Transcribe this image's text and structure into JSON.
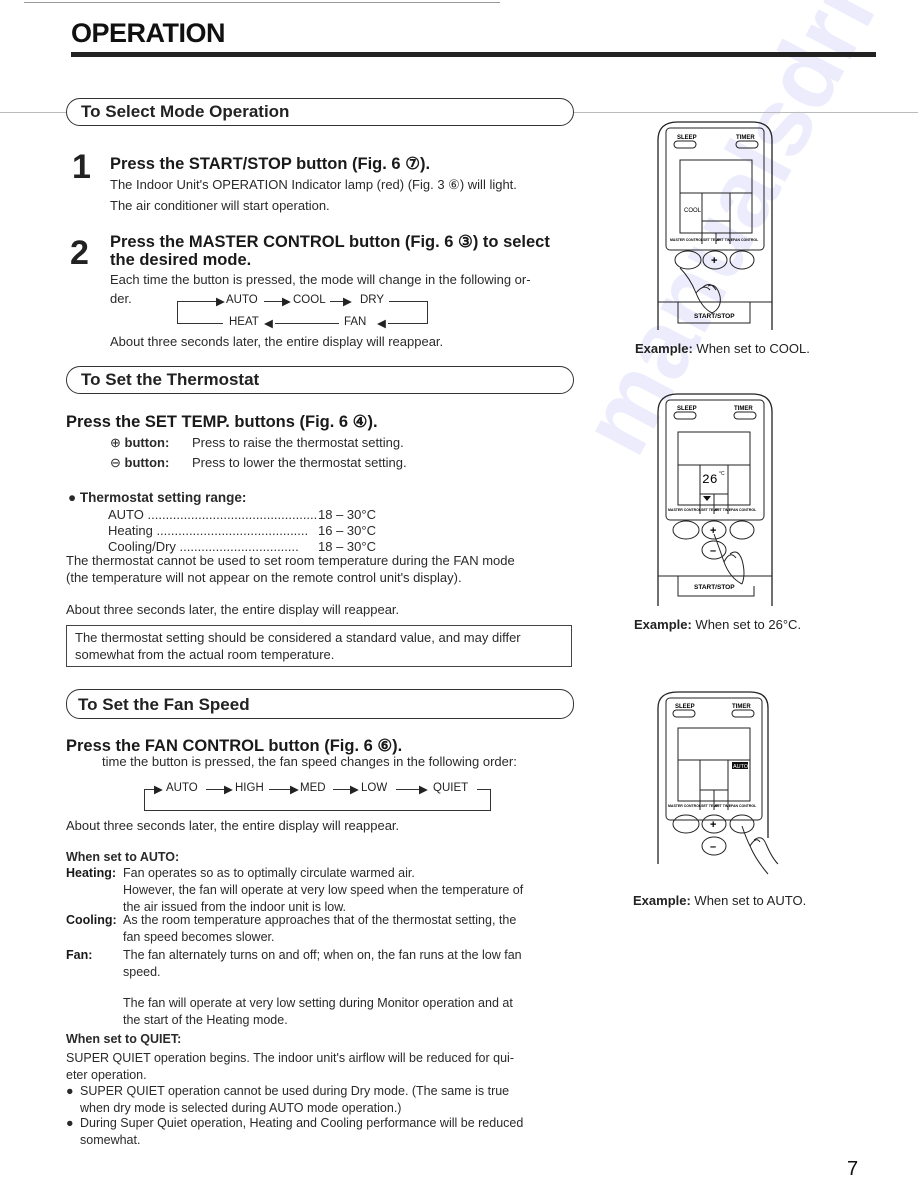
{
  "page": {
    "title": "OPERATION",
    "page_number": "7",
    "watermark": "manualsdrive.com"
  },
  "mode_section": {
    "heading": "To Select Mode Operation",
    "step1": {
      "number": "1",
      "title": "Press the START/STOP button (Fig. 6 ⑦).",
      "lines": [
        "The Indoor Unit's OPERATION Indicator lamp (red) (Fig. 3 ⑥) will light.",
        "The air conditioner will start operation."
      ]
    },
    "step2": {
      "number": "2",
      "title_line1": "Press the MASTER CONTROL button (Fig. 6 ③) to select",
      "title_line2": "the desired mode.",
      "text_line1": "Each time the button is pressed, the mode will change in the following or-",
      "text_line2": "der.",
      "flow_top": [
        "AUTO",
        "COOL",
        "DRY"
      ],
      "flow_bottom": [
        "HEAT",
        "FAN"
      ],
      "after": "About three seconds later, the entire display will reappear."
    },
    "remote": {
      "sleep": "SLEEP",
      "timer": "TIMER",
      "display_mode": "COOL",
      "labels": [
        "MASTER CONTROL",
        "SET TEMP.",
        "SET TIME",
        "FAN CONTROL"
      ],
      "plus": "+",
      "start_stop": "START/STOP",
      "example_bold": "Example:",
      "example_text": " When set to COOL."
    }
  },
  "thermostat_section": {
    "heading": "To Set the Thermostat",
    "title": "Press the SET TEMP. buttons (Fig. 6 ④).",
    "plus_button": {
      "icon": "⊕",
      "label": "button:",
      "desc": "Press to raise the thermostat setting."
    },
    "minus_button": {
      "icon": "⊖",
      "label": "button:",
      "desc": "Press to lower the thermostat setting."
    },
    "range_heading": "Thermostat setting range:",
    "ranges": [
      {
        "mode": "AUTO",
        "dots": "...............................................",
        "value": "18 – 30°C"
      },
      {
        "mode": "Heating",
        "dots": "..........................................",
        "value": "16 – 30°C"
      },
      {
        "mode": "Cooling/Dry",
        "dots": ".................................",
        "value": "18 – 30°C"
      }
    ],
    "fan_note_line1": "The thermostat cannot be used to set room temperature during the FAN mode",
    "fan_note_line2": "(the temperature will not appear on the remote control unit's display).",
    "after": "About three seconds later, the entire display will reappear.",
    "note_line1": "The thermostat setting should be considered a standard value, and may differ",
    "note_line2": "somewhat from the actual room temperature.",
    "remote": {
      "sleep": "SLEEP",
      "timer": "TIMER",
      "display_temp": "26",
      "display_unit": "°C",
      "labels": [
        "MASTER CONTROL",
        "SET TEMP.",
        "SET TIME",
        "FAN CONTROL"
      ],
      "plus": "+",
      "minus": "–",
      "start_stop": "START/STOP",
      "example_bold": "Example:",
      "example_text": " When set to 26°C."
    }
  },
  "fan_section": {
    "heading": "To Set the Fan Speed",
    "title": "Press the FAN CONTROL button (Fig. 6 ⑥).",
    "intro": "time the button is pressed, the fan speed changes in the following order:",
    "flow": [
      "AUTO",
      "HIGH",
      "MED",
      "LOW",
      "QUIET"
    ],
    "after": "About three seconds later, the entire display will reappear.",
    "auto_heading": "When set to AUTO:",
    "auto_items": [
      {
        "term": "Heating:",
        "lines": [
          "Fan operates so as to optimally circulate warmed air.",
          "However, the fan will operate at very low speed when the temperature of",
          "the air issued from the indoor unit is low."
        ]
      },
      {
        "term": "Cooling:",
        "lines": [
          "As the room temperature approaches that of the thermostat setting, the",
          "fan speed becomes slower."
        ]
      },
      {
        "term": "Fan:",
        "lines": [
          "The fan alternately turns on and off; when on, the fan runs at the low fan",
          "speed."
        ]
      }
    ],
    "monitor_note_line1": "The fan will operate at very low setting during Monitor operation and at",
    "monitor_note_line2": "the start of the Heating mode.",
    "quiet_heading": "When set to QUIET:",
    "quiet_line1": "SUPER QUIET operation begins. The indoor unit's airflow will be reduced for qui-",
    "quiet_line2": "eter operation.",
    "bullets": [
      {
        "line1": "SUPER QUIET operation cannot be used during Dry mode. (The same is true",
        "line2": "when dry mode is selected during AUTO mode operation.)"
      },
      {
        "line1": "During Super Quiet operation, Heating and Cooling performance will be reduced",
        "line2": "somewhat."
      }
    ],
    "remote": {
      "sleep": "SLEEP",
      "timer": "TIMER",
      "display_fan": "AUTO",
      "labels": [
        "MASTER CONTROL",
        "SET TEMP.",
        "SET TIME",
        "FAN CONTROL"
      ],
      "plus": "+",
      "minus": "–",
      "example_bold": "Example:",
      "example_text": " When set to AUTO."
    }
  }
}
